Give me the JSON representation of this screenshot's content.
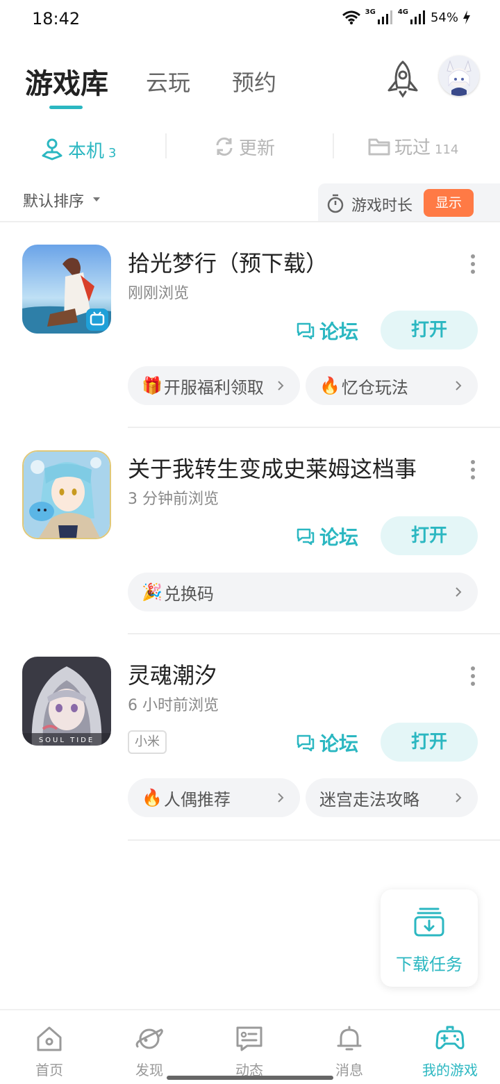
{
  "status_bar": {
    "time": "18:42",
    "network_1": "3G",
    "network_2": "4G",
    "battery": "54%"
  },
  "header": {
    "tabs": [
      {
        "label": "游戏库",
        "active": true
      },
      {
        "label": "云玩",
        "active": false
      },
      {
        "label": "预约",
        "active": false
      }
    ],
    "rocket_icon": "rocket-icon",
    "accent_color": "#2bb7c1"
  },
  "subtabs": [
    {
      "label": "本机",
      "count": "3",
      "icon": "device-icon",
      "active": true
    },
    {
      "label": "更新",
      "count": "",
      "icon": "refresh-icon",
      "active": false
    },
    {
      "label": "玩过",
      "count": "114",
      "icon": "folder-icon",
      "active": false
    }
  ],
  "sort": {
    "label": "默认排序",
    "playtime_label": "游戏时长",
    "playtime_toggle": "显示",
    "toggle_color": "#ff7a45"
  },
  "games": [
    {
      "title": "拾光梦行（预下载）",
      "subtitle": "刚刚浏览",
      "forum_label": "论坛",
      "open_label": "打开",
      "tag": "",
      "chips": [
        {
          "emoji": "🎁",
          "label": "开服福利领取"
        },
        {
          "emoji": "🔥",
          "label": "忆仓玩法"
        }
      ]
    },
    {
      "title": "关于我转生变成史莱姆这档事",
      "subtitle": "3 分钟前浏览",
      "forum_label": "论坛",
      "open_label": "打开",
      "tag": "",
      "chips": [
        {
          "emoji": "🎉",
          "label": "兑换码"
        }
      ]
    },
    {
      "title": "灵魂潮汐",
      "subtitle": "6 小时前浏览",
      "forum_label": "论坛",
      "open_label": "打开",
      "tag": "小米",
      "icon_caption": "SOUL TIDE",
      "chips": [
        {
          "emoji": "🔥",
          "label": "人偶推荐"
        },
        {
          "emoji": "",
          "label": "迷宫走法攻略"
        }
      ]
    }
  ],
  "download_tasks": {
    "label": "下载任务",
    "icon": "download-tray-icon"
  },
  "bottom_nav": [
    {
      "label": "首页",
      "icon": "home-icon",
      "active": false
    },
    {
      "label": "发现",
      "icon": "planet-icon",
      "active": false
    },
    {
      "label": "动态",
      "icon": "message-card-icon",
      "active": false
    },
    {
      "label": "消息",
      "icon": "bell-icon",
      "active": false
    },
    {
      "label": "我的游戏",
      "icon": "gamepad-icon",
      "active": true
    }
  ]
}
